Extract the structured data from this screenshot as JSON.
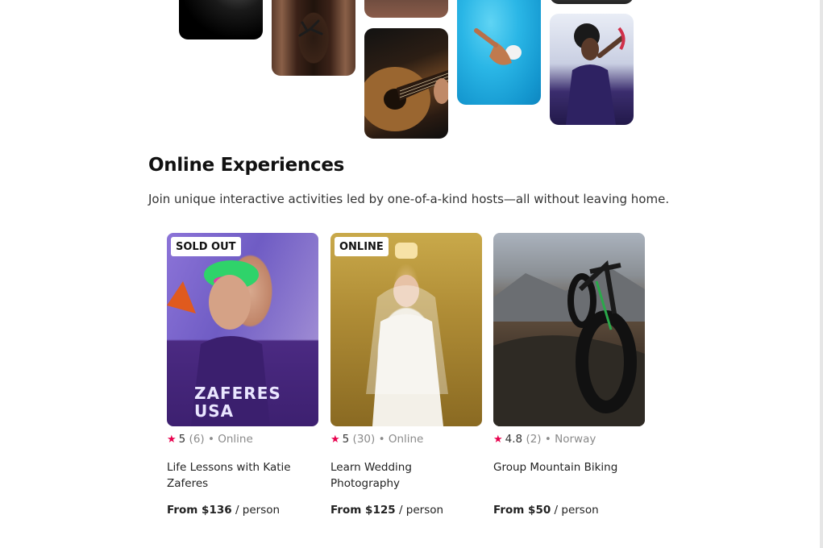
{
  "section": {
    "title": "Online Experiences",
    "subtitle": "Join unique interactive activities led by one-of-a-kind hosts—all without leaving home."
  },
  "cards": [
    {
      "badge": "SOLD OUT",
      "rating": "5",
      "reviews": "(6)",
      "location": "• Online",
      "title": "Life Lessons with Katie Zaferes",
      "price_label": "From $136",
      "price_unit": "/ person",
      "image_text": "ZAFERES USA"
    },
    {
      "badge": "ONLINE",
      "rating": "5",
      "reviews": "(30)",
      "location": "• Online",
      "title": "Learn Wedding Photography",
      "price_label": "From $125",
      "price_unit": "/ person"
    },
    {
      "badge": "",
      "rating": "4.8",
      "reviews": "(2)",
      "location": "• Norway",
      "title": "Group Mountain Biking",
      "price_label": "From $50",
      "price_unit": "/ person"
    }
  ],
  "icons": {
    "star": "star-icon"
  },
  "colors": {
    "star": "#e8004d",
    "muted": "#8a8a8a",
    "text": "#222222"
  }
}
